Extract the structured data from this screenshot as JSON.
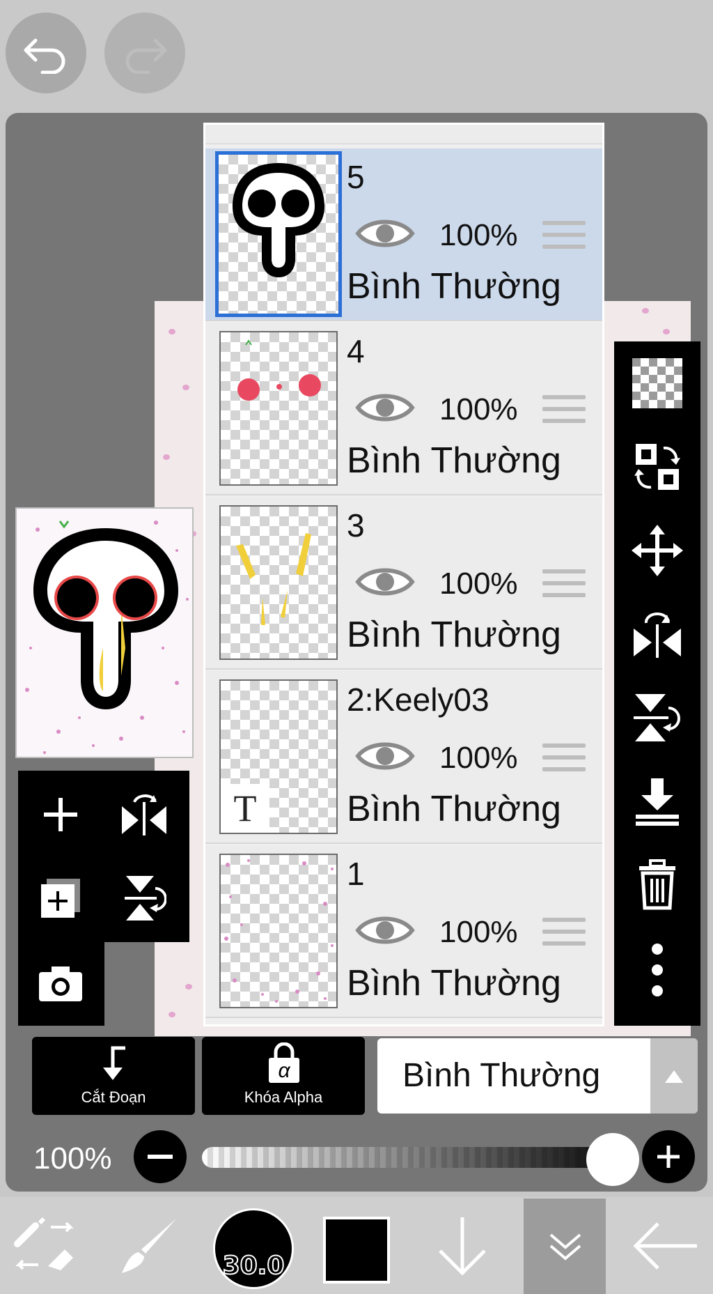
{
  "layers": [
    {
      "name": "5",
      "opacity": "100%",
      "blend": "Bình Thường",
      "selected": true
    },
    {
      "name": "4",
      "opacity": "100%",
      "blend": "Bình Thường",
      "selected": false
    },
    {
      "name": "3",
      "opacity": "100%",
      "blend": "Bình Thường",
      "selected": false
    },
    {
      "name": "2:Keely03",
      "opacity": "100%",
      "blend": "Bình Thường",
      "selected": false,
      "text_icon": "T"
    },
    {
      "name": "1",
      "opacity": "100%",
      "blend": "Bình Thường",
      "selected": false
    }
  ],
  "actions": {
    "clipping_label": "Cắt Đoạn",
    "alpha_lock_label": "Khóa Alpha",
    "alpha_glyph": "α"
  },
  "blend_mode": {
    "value": "Bình Thường"
  },
  "layer_opacity": {
    "label": "100%",
    "value": 1.0
  },
  "brush": {
    "size": "30.0"
  },
  "colors": {
    "selection": "#2c6fd6",
    "primary": "#000000",
    "selected_row": "#ccd9eb"
  },
  "icons": {
    "top": [
      "undo-icon",
      "redo-icon"
    ],
    "left": [
      "add-layer-icon",
      "flip-horizontal-icon",
      "add-layer-copy-icon",
      "flip-vertical-icon",
      "camera-icon"
    ],
    "right": [
      "transparency-checker-icon",
      "swap-layer-icon",
      "move-icon",
      "flip-horizontal-icon",
      "flip-vertical-icon",
      "merge-down-icon",
      "trash-icon",
      "more-icon"
    ],
    "bottom": [
      "eraser-swap-icon",
      "brush-icon",
      "brush-size-indicator",
      "color-swatch",
      "arrow-down-icon",
      "chevrons-down-icon",
      "back-arrow-icon"
    ]
  }
}
